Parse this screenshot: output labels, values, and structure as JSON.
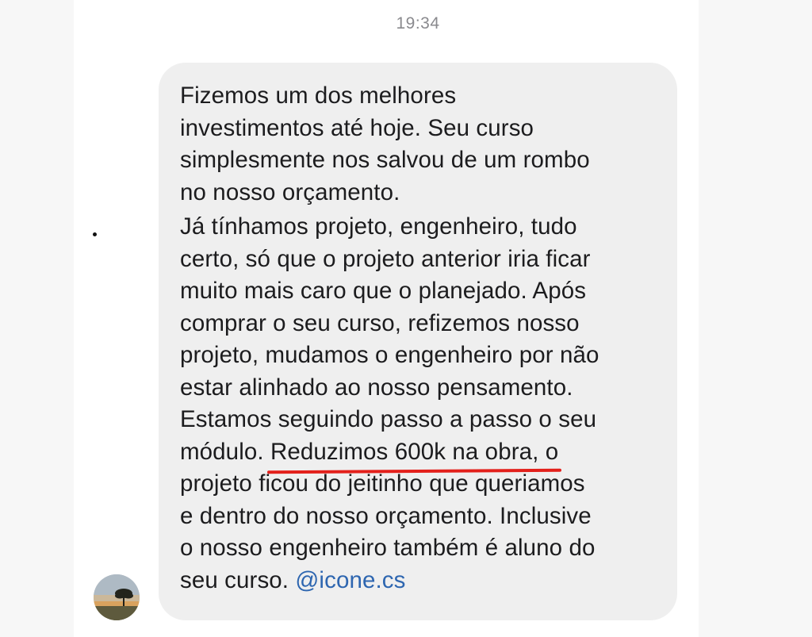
{
  "chat": {
    "timestamp": "19:34",
    "message": {
      "paragraph1": [
        "Fizemos um dos melhores",
        "investimentos até hoje. Seu curso",
        "simplesmente nos salvou de um rombo",
        "no nosso orçamento."
      ],
      "paragraph2": [
        "Já tínhamos projeto, engenheiro, tudo",
        "certo, só que o projeto anterior iria ficar",
        "muito mais caro que o planejado. Após",
        "comprar o seu curso, refizemos nosso",
        "projeto, mudamos o engenheiro por não",
        "estar alinhado ao nosso pensamento.",
        "Estamos seguindo passo a passo o seu"
      ],
      "highlight_line": {
        "before": "módulo. ",
        "highlighted": "Reduzimos 600k na obra, o"
      },
      "paragraph2_end": [
        "projeto ficou do jeitinho que queriamos",
        "e dentro do nosso orçamento. Inclusive",
        "o nosso engenheiro também é aluno do"
      ],
      "last_line": {
        "text": "seu curso. ",
        "mention": "@icone.cs"
      }
    },
    "colors": {
      "bubble": "#efefef",
      "text": "#1c1c1e",
      "mention": "#2e66b0",
      "underline": "#e3201b"
    }
  }
}
